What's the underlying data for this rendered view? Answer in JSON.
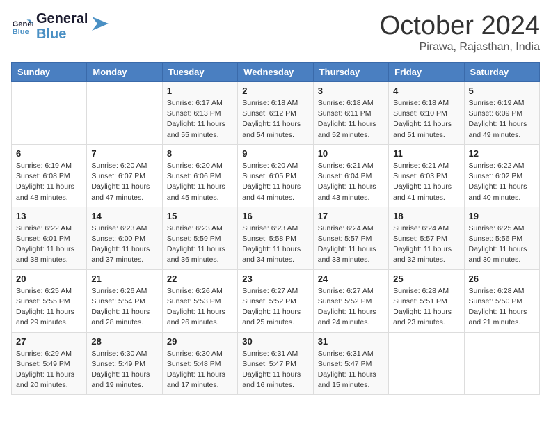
{
  "header": {
    "logo_general": "General",
    "logo_blue": "Blue",
    "month_title": "October 2024",
    "location": "Pirawa, Rajasthan, India"
  },
  "days_of_week": [
    "Sunday",
    "Monday",
    "Tuesday",
    "Wednesday",
    "Thursday",
    "Friday",
    "Saturday"
  ],
  "weeks": [
    [
      {
        "day": "",
        "info": ""
      },
      {
        "day": "",
        "info": ""
      },
      {
        "day": "1",
        "info": "Sunrise: 6:17 AM\nSunset: 6:13 PM\nDaylight: 11 hours and 55 minutes."
      },
      {
        "day": "2",
        "info": "Sunrise: 6:18 AM\nSunset: 6:12 PM\nDaylight: 11 hours and 54 minutes."
      },
      {
        "day": "3",
        "info": "Sunrise: 6:18 AM\nSunset: 6:11 PM\nDaylight: 11 hours and 52 minutes."
      },
      {
        "day": "4",
        "info": "Sunrise: 6:18 AM\nSunset: 6:10 PM\nDaylight: 11 hours and 51 minutes."
      },
      {
        "day": "5",
        "info": "Sunrise: 6:19 AM\nSunset: 6:09 PM\nDaylight: 11 hours and 49 minutes."
      }
    ],
    [
      {
        "day": "6",
        "info": "Sunrise: 6:19 AM\nSunset: 6:08 PM\nDaylight: 11 hours and 48 minutes."
      },
      {
        "day": "7",
        "info": "Sunrise: 6:20 AM\nSunset: 6:07 PM\nDaylight: 11 hours and 47 minutes."
      },
      {
        "day": "8",
        "info": "Sunrise: 6:20 AM\nSunset: 6:06 PM\nDaylight: 11 hours and 45 minutes."
      },
      {
        "day": "9",
        "info": "Sunrise: 6:20 AM\nSunset: 6:05 PM\nDaylight: 11 hours and 44 minutes."
      },
      {
        "day": "10",
        "info": "Sunrise: 6:21 AM\nSunset: 6:04 PM\nDaylight: 11 hours and 43 minutes."
      },
      {
        "day": "11",
        "info": "Sunrise: 6:21 AM\nSunset: 6:03 PM\nDaylight: 11 hours and 41 minutes."
      },
      {
        "day": "12",
        "info": "Sunrise: 6:22 AM\nSunset: 6:02 PM\nDaylight: 11 hours and 40 minutes."
      }
    ],
    [
      {
        "day": "13",
        "info": "Sunrise: 6:22 AM\nSunset: 6:01 PM\nDaylight: 11 hours and 38 minutes."
      },
      {
        "day": "14",
        "info": "Sunrise: 6:23 AM\nSunset: 6:00 PM\nDaylight: 11 hours and 37 minutes."
      },
      {
        "day": "15",
        "info": "Sunrise: 6:23 AM\nSunset: 5:59 PM\nDaylight: 11 hours and 36 minutes."
      },
      {
        "day": "16",
        "info": "Sunrise: 6:23 AM\nSunset: 5:58 PM\nDaylight: 11 hours and 34 minutes."
      },
      {
        "day": "17",
        "info": "Sunrise: 6:24 AM\nSunset: 5:57 PM\nDaylight: 11 hours and 33 minutes."
      },
      {
        "day": "18",
        "info": "Sunrise: 6:24 AM\nSunset: 5:57 PM\nDaylight: 11 hours and 32 minutes."
      },
      {
        "day": "19",
        "info": "Sunrise: 6:25 AM\nSunset: 5:56 PM\nDaylight: 11 hours and 30 minutes."
      }
    ],
    [
      {
        "day": "20",
        "info": "Sunrise: 6:25 AM\nSunset: 5:55 PM\nDaylight: 11 hours and 29 minutes."
      },
      {
        "day": "21",
        "info": "Sunrise: 6:26 AM\nSunset: 5:54 PM\nDaylight: 11 hours and 28 minutes."
      },
      {
        "day": "22",
        "info": "Sunrise: 6:26 AM\nSunset: 5:53 PM\nDaylight: 11 hours and 26 minutes."
      },
      {
        "day": "23",
        "info": "Sunrise: 6:27 AM\nSunset: 5:52 PM\nDaylight: 11 hours and 25 minutes."
      },
      {
        "day": "24",
        "info": "Sunrise: 6:27 AM\nSunset: 5:52 PM\nDaylight: 11 hours and 24 minutes."
      },
      {
        "day": "25",
        "info": "Sunrise: 6:28 AM\nSunset: 5:51 PM\nDaylight: 11 hours and 23 minutes."
      },
      {
        "day": "26",
        "info": "Sunrise: 6:28 AM\nSunset: 5:50 PM\nDaylight: 11 hours and 21 minutes."
      }
    ],
    [
      {
        "day": "27",
        "info": "Sunrise: 6:29 AM\nSunset: 5:49 PM\nDaylight: 11 hours and 20 minutes."
      },
      {
        "day": "28",
        "info": "Sunrise: 6:30 AM\nSunset: 5:49 PM\nDaylight: 11 hours and 19 minutes."
      },
      {
        "day": "29",
        "info": "Sunrise: 6:30 AM\nSunset: 5:48 PM\nDaylight: 11 hours and 17 minutes."
      },
      {
        "day": "30",
        "info": "Sunrise: 6:31 AM\nSunset: 5:47 PM\nDaylight: 11 hours and 16 minutes."
      },
      {
        "day": "31",
        "info": "Sunrise: 6:31 AM\nSunset: 5:47 PM\nDaylight: 11 hours and 15 minutes."
      },
      {
        "day": "",
        "info": ""
      },
      {
        "day": "",
        "info": ""
      }
    ]
  ]
}
